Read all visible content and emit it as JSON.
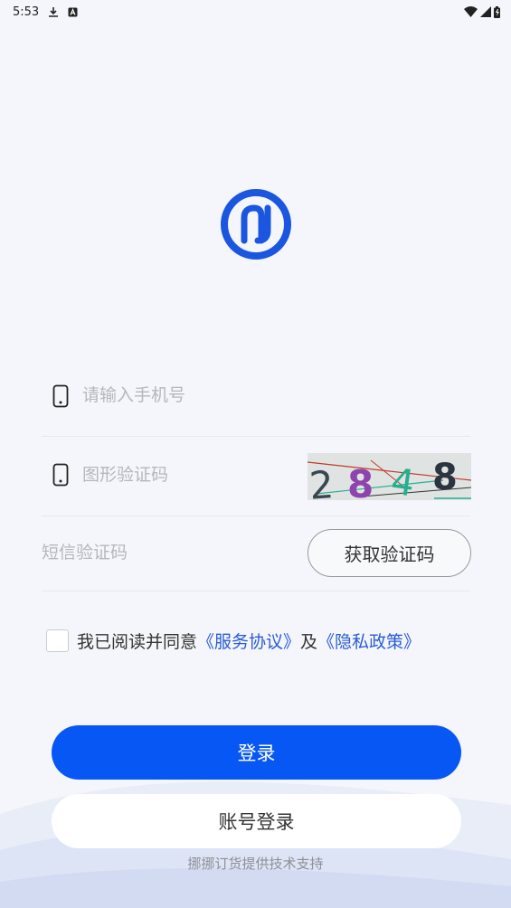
{
  "status_bar": {
    "time": "5:53",
    "left_icons": [
      "download-icon",
      "a-badge-icon"
    ],
    "right_icons": [
      "wifi-icon",
      "signal-icon",
      "battery-icon"
    ]
  },
  "logo": {
    "icon": "brand-logo-icon",
    "color": "#1a56e0"
  },
  "form": {
    "phone": {
      "placeholder": "请输入手机号",
      "icon": "phone-icon"
    },
    "captcha": {
      "placeholder": "图形验证码",
      "icon": "phone-icon",
      "image_text": [
        "2",
        "8",
        "4",
        "8"
      ]
    },
    "sms": {
      "placeholder": "短信验证码",
      "button_label": "获取验证码"
    }
  },
  "agreement": {
    "prefix": "我已阅读并同意",
    "service_link": "《服务协议》",
    "connector": "及",
    "privacy_link": "《隐私政策》",
    "link_color": "#2a5bd7"
  },
  "buttons": {
    "login_label": "登录",
    "login_color": "#0757f5",
    "account_login_label": "账号登录"
  },
  "footer": {
    "text": "挪挪订货提供技术支持"
  }
}
